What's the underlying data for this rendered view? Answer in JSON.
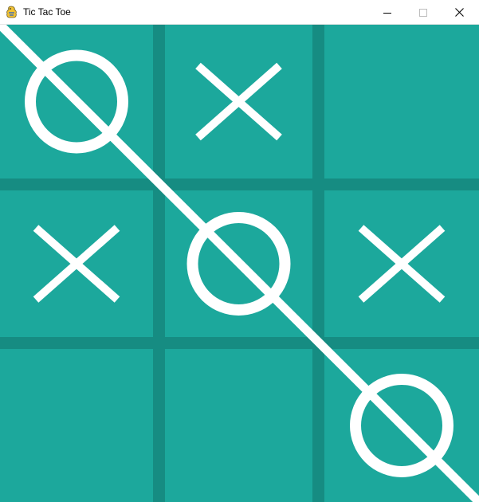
{
  "window": {
    "title": "Tic Tac Toe",
    "icon": "pygame-snake-icon",
    "controls": [
      "minimize-icon",
      "maximize-icon",
      "close-icon"
    ]
  },
  "colors": {
    "board": "#1ca89c",
    "grid_line": "#168c82",
    "mark": "#ffffff",
    "titlebar": "#ffffff"
  },
  "board": {
    "cells": [
      [
        "O",
        "X",
        ""
      ],
      [
        "X",
        "O",
        "X"
      ],
      [
        "",
        "",
        "O"
      ]
    ],
    "winning_line": "main-diagonal"
  }
}
